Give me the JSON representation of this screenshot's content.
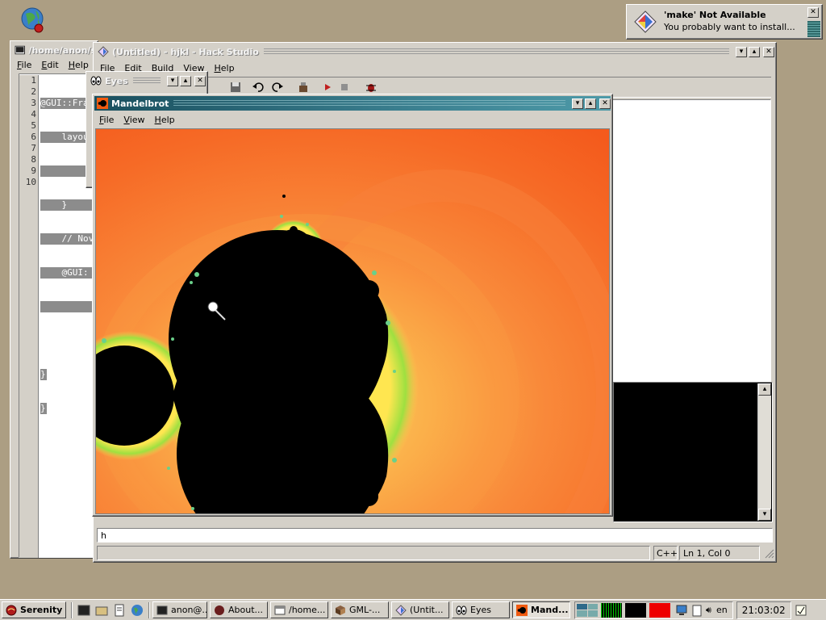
{
  "notification": {
    "title": "'make' Not Available",
    "message": "You probably want to install..."
  },
  "terminal": {
    "title": "/home/anon/s",
    "menu": [
      "File",
      "Edit",
      "Help"
    ],
    "line_numbers": [
      "1",
      "2",
      "3",
      "4",
      "5",
      "6",
      "7",
      "8",
      "9",
      "10"
    ],
    "code_lines": [
      "@GUI::Fran",
      "    layout",
      "        ",
      "    }",
      "    // Nov",
      "    @GUI:",
      "",
      "",
      "}",
      "}"
    ]
  },
  "hackstudio": {
    "title": "(Untitled) - hjkl - Hack Studio",
    "menu": [
      "File",
      "Edit",
      "Build",
      "View",
      "Help"
    ],
    "terminal_input": "h",
    "status_lang": "C++",
    "status_pos": "Ln 1, Col 0"
  },
  "eyes": {
    "title": "Eyes"
  },
  "mandelbrot": {
    "title": "Mandelbrot",
    "menu": [
      "File",
      "View",
      "Help"
    ]
  },
  "taskbar": {
    "start_label": "Serenity",
    "buttons": [
      {
        "label": "anon@...",
        "icon": "terminal-icon"
      },
      {
        "label": "About...",
        "icon": "serenity-icon"
      },
      {
        "label": "/home...",
        "icon": "folder-window-icon"
      },
      {
        "label": "GML-...",
        "icon": "book-icon"
      },
      {
        "label": "(Untit...",
        "icon": "hackstudio-icon"
      },
      {
        "label": "Eyes",
        "icon": "eyes-icon"
      },
      {
        "label": "Mand...",
        "icon": "mandelbrot-icon"
      }
    ],
    "keyboard_layout": "en",
    "clock": "21:03:02"
  },
  "colors": {
    "desktop": "#ac9e83",
    "active_title": "#1a4f5e",
    "window_face": "#d4d0c8"
  }
}
